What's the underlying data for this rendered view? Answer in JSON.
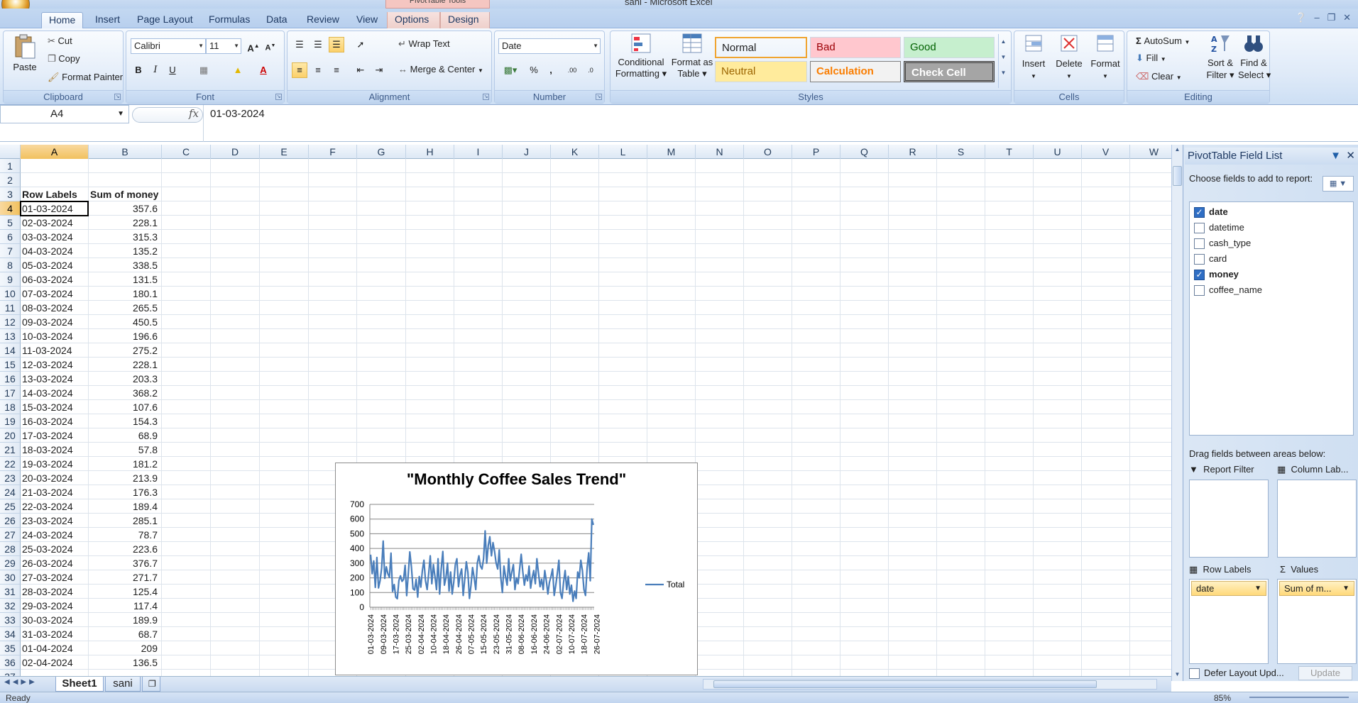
{
  "window": {
    "title": "sani - Microsoft Excel",
    "contextual_group": "PivotTable Tools"
  },
  "tabs": [
    "Home",
    "Insert",
    "Page Layout",
    "Formulas",
    "Data",
    "Review",
    "View",
    "Options",
    "Design"
  ],
  "ribbon": {
    "clipboard": {
      "label": "Clipboard",
      "paste": "Paste",
      "cut": "Cut",
      "copy": "Copy",
      "format_painter": "Format Painter"
    },
    "font": {
      "label": "Font",
      "name": "Calibri",
      "size": "11",
      "bold": "B",
      "italic": "I",
      "underline": "U"
    },
    "alignment": {
      "label": "Alignment",
      "wrap": "Wrap Text",
      "merge": "Merge & Center"
    },
    "number": {
      "label": "Number",
      "format": "Date",
      "percent": "%",
      "comma": ","
    },
    "styles": {
      "label": "Styles",
      "conditional": [
        "Conditional",
        "Formatting"
      ],
      "format_table": [
        "Format as",
        "Table"
      ],
      "items": [
        {
          "name": "Normal",
          "bg": "#ffffff",
          "fg": "#000000"
        },
        {
          "name": "Bad",
          "bg": "#ffc7ce",
          "fg": "#9c0006"
        },
        {
          "name": "Good",
          "bg": "#c6efce",
          "fg": "#006100"
        },
        {
          "name": "Neutral",
          "bg": "#ffeb9c",
          "fg": "#9c6500"
        },
        {
          "name": "Calculation",
          "bg": "#f2f2f2",
          "fg": "#fa7d00"
        },
        {
          "name": "Check Cell",
          "bg": "#a5a5a5",
          "fg": "#ffffff"
        }
      ]
    },
    "cells": {
      "label": "Cells",
      "insert": "Insert",
      "delete": "Delete",
      "format": "Format"
    },
    "editing": {
      "label": "Editing",
      "autosum": "AutoSum",
      "fill": "Fill",
      "clear": "Clear",
      "sort": [
        "Sort &",
        "Filter"
      ],
      "find": [
        "Find &",
        "Select"
      ]
    }
  },
  "formula_bar": {
    "name_box": "A4",
    "fx": "fx",
    "value": "01-03-2024"
  },
  "columns": [
    "A",
    "B",
    "C",
    "D",
    "E",
    "F",
    "G",
    "H",
    "I",
    "J",
    "K",
    "L",
    "M",
    "N",
    "O",
    "P",
    "Q",
    "R",
    "S",
    "T",
    "U",
    "V",
    "W"
  ],
  "rows": [
    "1",
    "2",
    "3",
    "4",
    "5",
    "6",
    "7",
    "8",
    "9",
    "10",
    "11",
    "12",
    "13",
    "14",
    "15",
    "16",
    "17",
    "18",
    "19",
    "20",
    "21",
    "22",
    "23",
    "24",
    "25",
    "26",
    "27",
    "28",
    "29",
    "30",
    "31",
    "32",
    "33",
    "34",
    "35",
    "36",
    "37"
  ],
  "pivot_table": {
    "header": [
      "Row Labels",
      "Sum of money"
    ],
    "rows": [
      [
        "01-03-2024",
        "357.6"
      ],
      [
        "02-03-2024",
        "228.1"
      ],
      [
        "03-03-2024",
        "315.3"
      ],
      [
        "04-03-2024",
        "135.2"
      ],
      [
        "05-03-2024",
        "338.5"
      ],
      [
        "06-03-2024",
        "131.5"
      ],
      [
        "07-03-2024",
        "180.1"
      ],
      [
        "08-03-2024",
        "265.5"
      ],
      [
        "09-03-2024",
        "450.5"
      ],
      [
        "10-03-2024",
        "196.6"
      ],
      [
        "11-03-2024",
        "275.2"
      ],
      [
        "12-03-2024",
        "228.1"
      ],
      [
        "13-03-2024",
        "203.3"
      ],
      [
        "14-03-2024",
        "368.2"
      ],
      [
        "15-03-2024",
        "107.6"
      ],
      [
        "16-03-2024",
        "154.3"
      ],
      [
        "17-03-2024",
        "68.9"
      ],
      [
        "18-03-2024",
        "57.8"
      ],
      [
        "19-03-2024",
        "181.2"
      ],
      [
        "20-03-2024",
        "213.9"
      ],
      [
        "21-03-2024",
        "176.3"
      ],
      [
        "22-03-2024",
        "189.4"
      ],
      [
        "23-03-2024",
        "285.1"
      ],
      [
        "24-03-2024",
        "78.7"
      ],
      [
        "25-03-2024",
        "223.6"
      ],
      [
        "26-03-2024",
        "376.7"
      ],
      [
        "27-03-2024",
        "271.7"
      ],
      [
        "28-03-2024",
        "125.4"
      ],
      [
        "29-03-2024",
        "117.4"
      ],
      [
        "30-03-2024",
        "189.9"
      ],
      [
        "31-03-2024",
        "68.7"
      ],
      [
        "01-04-2024",
        "209"
      ],
      [
        "02-04-2024",
        "136.5"
      ]
    ]
  },
  "chart_data": {
    "type": "line",
    "title": "\"Monthly Coffee Sales Trend\"",
    "ylim": [
      0,
      700
    ],
    "yticks": [
      "0",
      "100",
      "200",
      "300",
      "400",
      "500",
      "600",
      "700"
    ],
    "xtick_labels": [
      "01-03-2024",
      "09-03-2024",
      "17-03-2024",
      "25-03-2024",
      "02-04-2024",
      "10-04-2024",
      "18-04-2024",
      "26-04-2024",
      "07-05-2024",
      "15-05-2024",
      "23-05-2024",
      "31-05-2024",
      "08-06-2024",
      "16-06-2024",
      "24-06-2024",
      "02-07-2024",
      "10-07-2024",
      "18-07-2024",
      "26-07-2024"
    ],
    "series": [
      {
        "name": "Total",
        "color": "#4a7ebb",
        "values": [
          357.6,
          228.1,
          315.3,
          135.2,
          338.5,
          131.5,
          180.1,
          265.5,
          450.5,
          196.6,
          275.2,
          228.1,
          203.3,
          368.2,
          107.6,
          154.3,
          68.9,
          57.8,
          181.2,
          213.9,
          176.3,
          189.4,
          285.1,
          78.7,
          223.6,
          376.7,
          271.7,
          125.4,
          117.4,
          189.9,
          68.7,
          209,
          136.5,
          250,
          320,
          180,
          120,
          230,
          350,
          160,
          290,
          210,
          120,
          330,
          90,
          260,
          380,
          150,
          200,
          300,
          110,
          240,
          90,
          170,
          290,
          330,
          140,
          220,
          260,
          80,
          190,
          310,
          240,
          60,
          150,
          270,
          200,
          120,
          300,
          350,
          280,
          260,
          330,
          520,
          300,
          420,
          480,
          350,
          440,
          380,
          300,
          260,
          390,
          200,
          100,
          280,
          210,
          150,
          330,
          180,
          240,
          290,
          120,
          200,
          160,
          260,
          360,
          240,
          150,
          220,
          180,
          280,
          130,
          200,
          250,
          160,
          330,
          230,
          140,
          190,
          120,
          250,
          180,
          90,
          170,
          210,
          260,
          80,
          150,
          230,
          320,
          100,
          60,
          170,
          250,
          120,
          210,
          90,
          150,
          40,
          110,
          60,
          240,
          200,
          320,
          250,
          120,
          80,
          270,
          370,
          180,
          600,
          560
        ]
      }
    ]
  },
  "pivot_panel": {
    "title": "PivotTable Field List",
    "choose": "Choose fields to add to report:",
    "fields": [
      {
        "name": "date",
        "checked": true
      },
      {
        "name": "datetime",
        "checked": false
      },
      {
        "name": "cash_type",
        "checked": false
      },
      {
        "name": "card",
        "checked": false
      },
      {
        "name": "money",
        "checked": true
      },
      {
        "name": "coffee_name",
        "checked": false
      }
    ],
    "drag_hint": "Drag fields between areas below:",
    "report_filter": "Report Filter",
    "column_labels": "Column Lab...",
    "row_labels": "Row Labels",
    "values": "Values",
    "row_pill": "date",
    "value_pill": "Sum of m...",
    "defer": "Defer Layout Upd...",
    "update": "Update"
  },
  "sheets": [
    "Sheet1",
    "sani"
  ],
  "status": {
    "left": "Ready",
    "zoom": "85%"
  }
}
